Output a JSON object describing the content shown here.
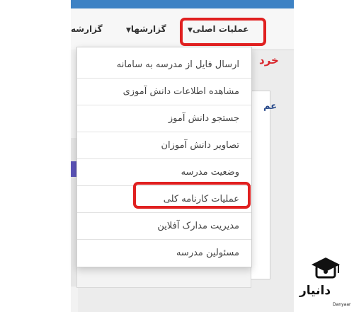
{
  "navbar": {
    "main_ops": "عملیات اصلی",
    "reports": "گزارشها",
    "reports_cut": "گزارشه"
  },
  "page": {
    "red_heading": "خرد",
    "blue_heading": "عم"
  },
  "dropdown": {
    "items": [
      {
        "label": "ارسال فایل از مدرسه به سامانه"
      },
      {
        "label": "مشاهده اطلاعات دانش آموزی"
      },
      {
        "label": "جستجو دانش آموز"
      },
      {
        "label": "تصاویر دانش آموزان"
      },
      {
        "label": "وضعیت مدرسه"
      },
      {
        "label": "عملیات کارنامه کلی"
      },
      {
        "label": "مدیریت مدارک آفلاین"
      },
      {
        "label": "مسئولین مدرسه"
      }
    ]
  },
  "watermark": {
    "name": "دانیار",
    "sub": "Danyaar"
  },
  "colors": {
    "highlight": "#e02020",
    "accent_blue": "#3d82c4",
    "alert_red": "#d9262c"
  }
}
